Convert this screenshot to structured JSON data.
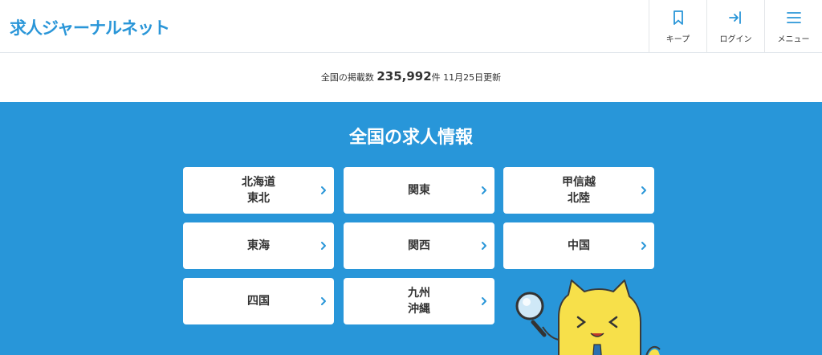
{
  "header": {
    "logo": "求人ジャーナルネット",
    "nav": [
      {
        "label": "キープ",
        "icon": "bookmark-icon"
      },
      {
        "label": "ログイン",
        "icon": "login-icon"
      },
      {
        "label": "メニュー",
        "icon": "menu-icon"
      }
    ]
  },
  "listing": {
    "prefix": "全国の掲載数",
    "count": "235,992",
    "unit": "件",
    "updated": "11月25日更新"
  },
  "main": {
    "title": "全国の求人情報",
    "regions": [
      {
        "label": "北海道\n東北"
      },
      {
        "label": "関東"
      },
      {
        "label": "甲信越\n北陸"
      },
      {
        "label": "東海"
      },
      {
        "label": "関西"
      },
      {
        "label": "中国"
      },
      {
        "label": "四国"
      },
      {
        "label": "九州\n沖縄"
      }
    ]
  },
  "colors": {
    "brand": "#2a96d8",
    "main_bg": "#2896d9",
    "mascot": "#f7e04a"
  }
}
